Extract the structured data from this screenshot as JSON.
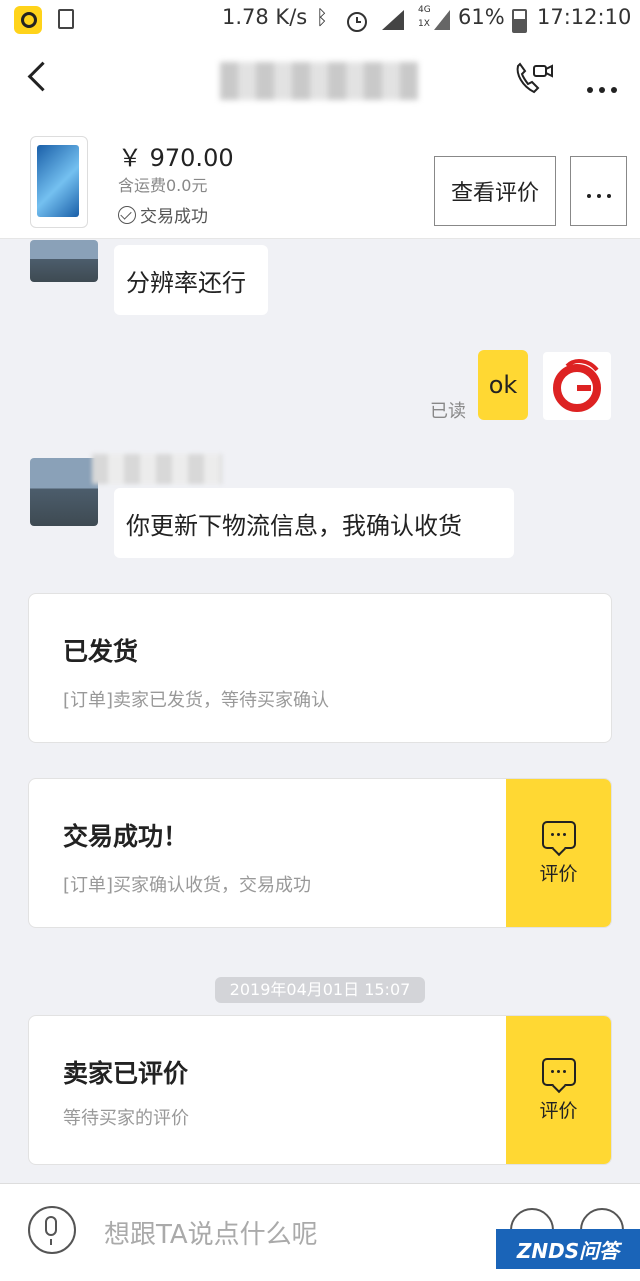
{
  "status_bar": {
    "net_speed": "1.78 K/s",
    "net_badge_top": "4G",
    "net_badge_bottom": "1X",
    "battery": "61%",
    "time": "17:12:10"
  },
  "product": {
    "price": "￥ 970.00",
    "shipping": "含运费0.0元",
    "status": "交易成功",
    "review_button": "查看评价"
  },
  "messages": [
    {
      "text": "分辨率还行"
    },
    {
      "text": "ok",
      "read": "已读"
    },
    {
      "text": "你更新下物流信息，我确认收货"
    }
  ],
  "cards": [
    {
      "title": "已发货",
      "desc": "[订单]卖家已发货，等待买家确认"
    },
    {
      "title": "交易成功！",
      "desc": "[订单]买家确认收货，交易成功",
      "action": "评价"
    },
    {
      "title": "卖家已评价",
      "desc": "等待买家的评价",
      "action": "评价"
    }
  ],
  "timestamp": "2019年04月01日 15:07",
  "input": {
    "placeholder": "想跟TA说点什么呢"
  },
  "watermark": "ZNDS问答",
  "icons": [
    "app-icon",
    "download-icon",
    "bluetooth-icon",
    "alarm-icon",
    "signal-icon",
    "battery-icon",
    "back-icon",
    "video-call-icon",
    "more-icon",
    "check-circle-icon",
    "chat-icon",
    "mic-icon",
    "emoji-icon",
    "plus-icon"
  ]
}
